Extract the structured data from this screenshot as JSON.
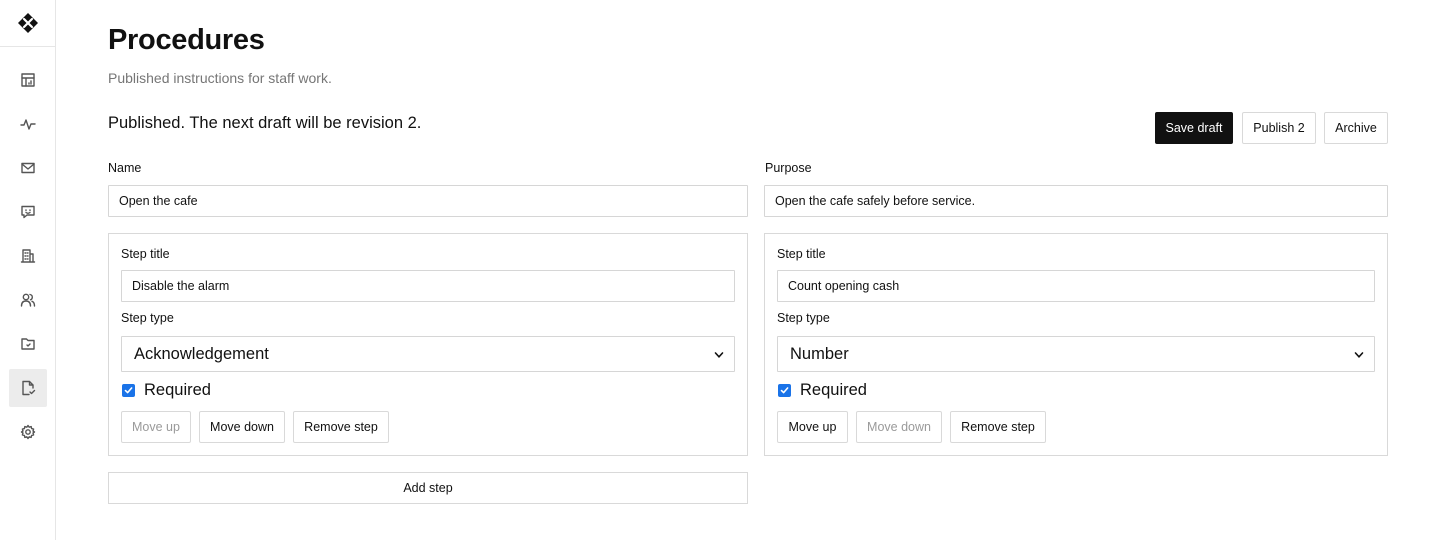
{
  "sidebar": {
    "logo": "logo-icon",
    "items": [
      {
        "icon": "dashboard-icon",
        "label": "dashboard"
      },
      {
        "icon": "activity-icon",
        "label": "activity"
      },
      {
        "icon": "mail-icon",
        "label": "messages"
      },
      {
        "icon": "chat-icon",
        "label": "feedback"
      },
      {
        "icon": "building-icon",
        "label": "locations"
      },
      {
        "icon": "users-icon",
        "label": "staff"
      },
      {
        "icon": "folder-icon",
        "label": "documents"
      },
      {
        "icon": "procedure-icon",
        "label": "procedures",
        "active": true
      },
      {
        "icon": "gear-icon",
        "label": "settings"
      }
    ]
  },
  "header": {
    "title": "Procedures",
    "subtitle": "Published instructions for staff work."
  },
  "status": "Published. The next draft will be revision 2.",
  "actions": {
    "save_draft": "Save draft",
    "publish": "Publish 2",
    "archive": "Archive"
  },
  "form": {
    "name_label": "Name",
    "name_value": "Open the cafe",
    "purpose_label": "Purpose",
    "purpose_value": "Open the cafe safely before service."
  },
  "steps": [
    {
      "title_label": "Step title",
      "title_value": "Disable the alarm",
      "type_label": "Step type",
      "type_value": "Acknowledgement",
      "required_label": "Required",
      "required": true,
      "move_up": "Move up",
      "move_up_disabled": true,
      "move_down": "Move down",
      "move_down_disabled": false,
      "remove": "Remove step"
    },
    {
      "title_label": "Step title",
      "title_value": "Count opening cash",
      "type_label": "Step type",
      "type_value": "Number",
      "required_label": "Required",
      "required": true,
      "move_up": "Move up",
      "move_up_disabled": false,
      "move_down": "Move down",
      "move_down_disabled": true,
      "remove": "Remove step"
    }
  ],
  "add_step": "Add step",
  "colors": {
    "primary": "#111111",
    "checkbox": "#1a73e8",
    "border": "#d9d9d9",
    "muted": "#767676"
  }
}
